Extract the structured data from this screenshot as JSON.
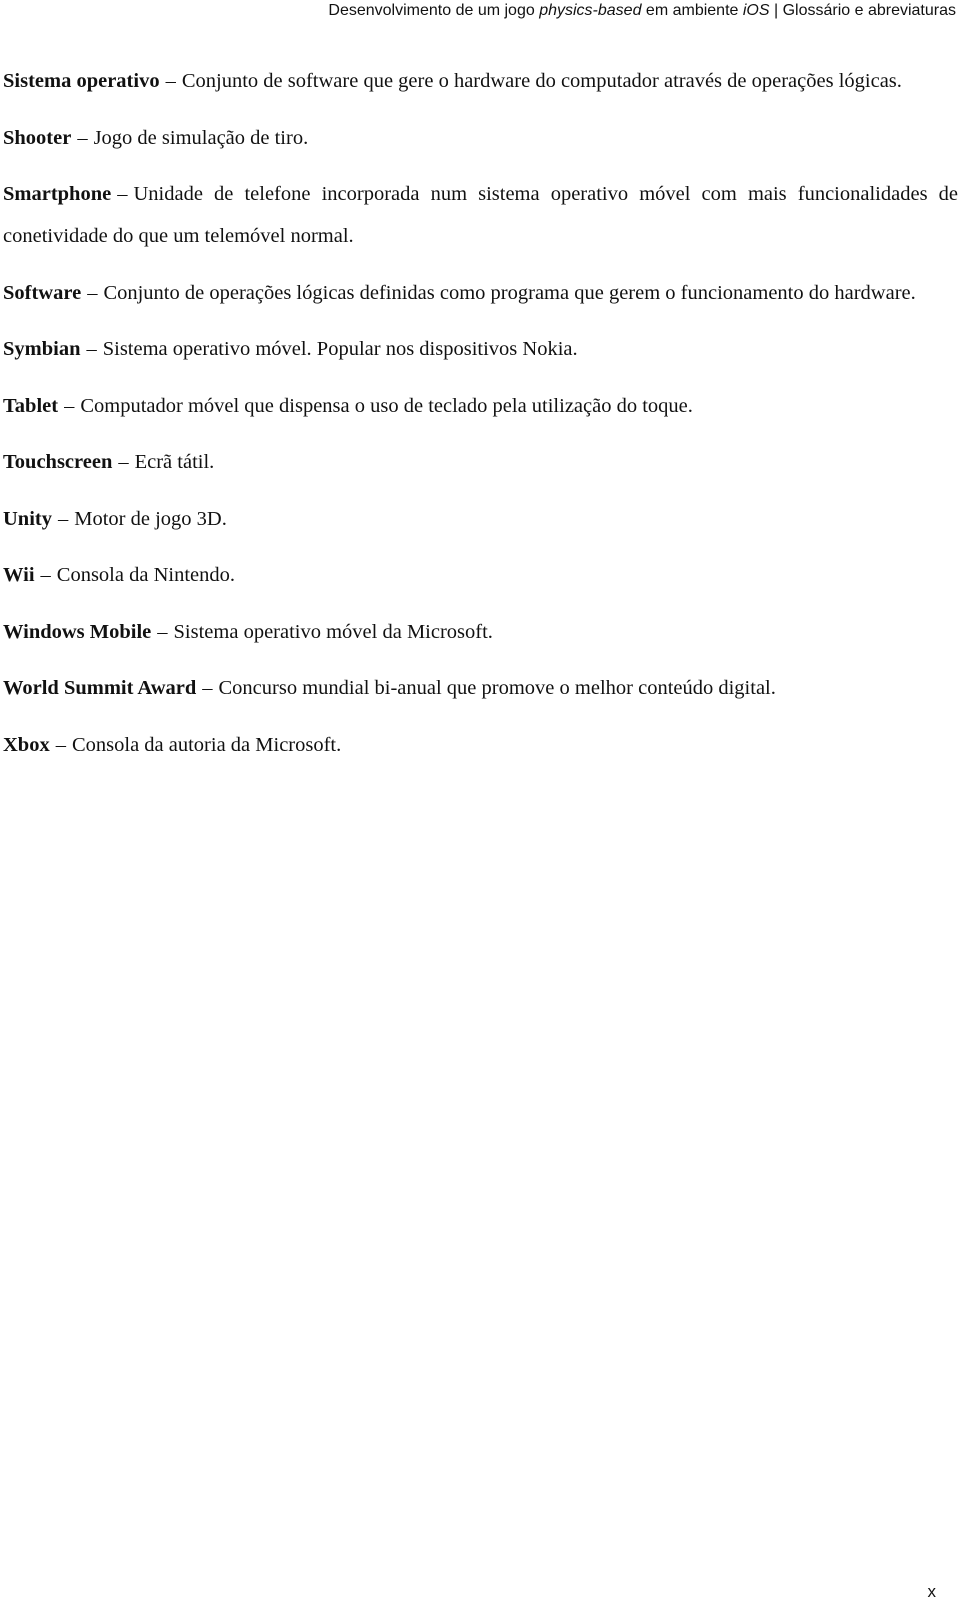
{
  "header": {
    "part1": "Desenvolvimento de um jogo ",
    "part2_italic": "physics-based",
    "part3": " em ambiente ",
    "part4_italic": "iOS",
    "part5": " | Glossário e abreviaturas"
  },
  "separator": "–",
  "entries": [
    {
      "term": "Sistema operativo",
      "definition": "Conjunto de software que gere o hardware do computador através de operações lógicas."
    },
    {
      "term": "Shooter",
      "definition": "Jogo de simulação de tiro."
    },
    {
      "term": "Smartphone",
      "definition": "Unidade de telefone incorporada num sistema operativo móvel com mais funcionalidades de conetividade do que um telemóvel normal."
    },
    {
      "term": "Software",
      "definition": "Conjunto de operações lógicas definidas como programa que gerem o funcionamento do hardware."
    },
    {
      "term": "Symbian",
      "definition": "Sistema operativo móvel. Popular nos dispositivos Nokia."
    },
    {
      "term": "Tablet",
      "definition": "Computador móvel que dispensa o uso de teclado pela utilização do toque."
    },
    {
      "term": "Touchscreen",
      "definition": "Ecrã tátil."
    },
    {
      "term": "Unity",
      "definition": "Motor de jogo 3D."
    },
    {
      "term": "Wii",
      "definition": "Consola da Nintendo."
    },
    {
      "term": "Windows Mobile",
      "definition": "Sistema operativo móvel da Microsoft."
    },
    {
      "term": "World Summit Award",
      "definition": "Concurso mundial bi-anual que promove o melhor conteúdo digital."
    },
    {
      "term": "Xbox",
      "definition": "Consola da autoria da Microsoft."
    }
  ],
  "page_number": "x"
}
